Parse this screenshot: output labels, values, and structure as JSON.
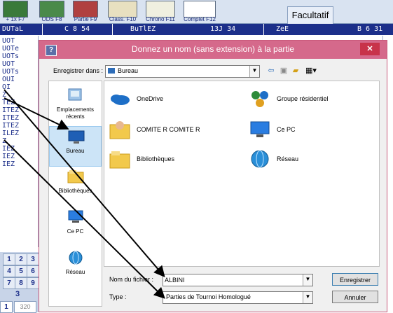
{
  "toolbar": {
    "buttons": [
      {
        "label": "+ 1x F7",
        "icon": "game-icon"
      },
      {
        "label": "ODS F8",
        "icon": "board-icon"
      },
      {
        "label": "Partie F9",
        "icon": "game-board-icon"
      },
      {
        "label": "Class. F10",
        "icon": "ranking-icon"
      },
      {
        "label": "Chrono F11",
        "icon": "clock-icon"
      },
      {
        "label": "Complet F12",
        "icon": "complete-icon"
      }
    ],
    "tab_label": "Facultatif"
  },
  "header": {
    "cells": [
      "DUTaL",
      "C 8 54",
      "BuTlEZ",
      "13J 34",
      "ZeE",
      "B 6 31"
    ]
  },
  "rack_rows": [
    "UOT",
    "UOTe",
    "UOTs",
    "UOT",
    "UOTs",
    "OUI",
    "OI",
    "Z",
    "TEZ",
    "ITEZ",
    "ITEZ",
    "ITEZ",
    "ILEZ",
    "Z",
    "IEZ",
    "IEZ",
    "IEZ"
  ],
  "numpad": {
    "keys": [
      "1",
      "2",
      "3",
      "4",
      "5",
      "6",
      "7",
      "8",
      "9"
    ],
    "count": "3",
    "bottom_left": "1",
    "bottom_right": "320"
  },
  "dialog": {
    "title": "Donnez un nom (sans extension) à la partie",
    "app_icon": "?",
    "close_label": "✕",
    "look_in_label": "Enregistrer dans :",
    "look_in_value": "Bureau",
    "places": [
      {
        "label": "Emplacements récents",
        "icon": "recent-places-icon"
      },
      {
        "label": "Bureau",
        "icon": "desktop-icon"
      },
      {
        "label": "Bibliothèques",
        "icon": "libraries-icon"
      },
      {
        "label": "Ce PC",
        "icon": "computer-icon"
      },
      {
        "label": "Réseau",
        "icon": "network-icon"
      }
    ],
    "files": [
      {
        "label": "OneDrive",
        "icon": "onedrive-icon"
      },
      {
        "label": "Groupe résidentiel",
        "icon": "homegroup-icon"
      },
      {
        "label": "COMITE R COMITE R",
        "icon": "user-folder-icon"
      },
      {
        "label": "Ce PC",
        "icon": "computer-icon"
      },
      {
        "label": "Bibliothèques",
        "icon": "libraries-icon"
      },
      {
        "label": "Réseau",
        "icon": "network-icon"
      }
    ],
    "filename_label": "Nom du fichier :",
    "filename_value": "ALBINI",
    "type_label": "Type :",
    "type_value": "Parties de Tournoi Homologué",
    "save_label": "Enregistrer",
    "cancel_label": "Annuler"
  },
  "colors": {
    "title_bar": "#d5698b",
    "header_bar": "#1c2f8a",
    "arrow": "#000000"
  }
}
